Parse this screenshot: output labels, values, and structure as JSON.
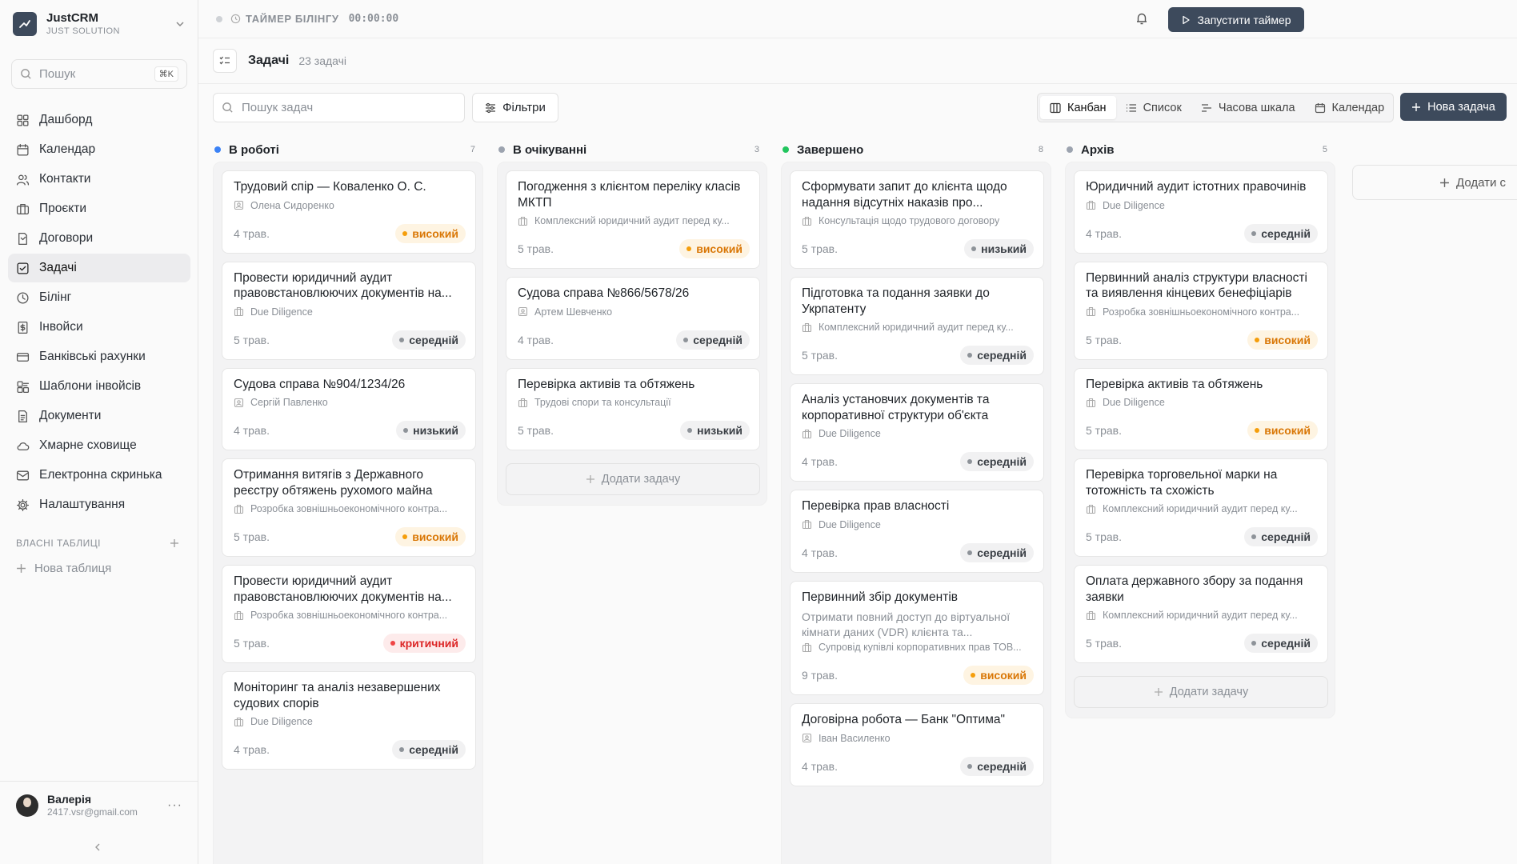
{
  "sidebar": {
    "brand_name": "JustCRM",
    "brand_sub": "JUST SOLUTION",
    "search_placeholder": "Пошук",
    "search_shortcut": "⌘K",
    "items": [
      {
        "label": "Дашборд",
        "icon": "dashboard-icon"
      },
      {
        "label": "Календар",
        "icon": "calendar-icon"
      },
      {
        "label": "Контакти",
        "icon": "users-icon"
      },
      {
        "label": "Проєкти",
        "icon": "briefcase-icon"
      },
      {
        "label": "Договори",
        "icon": "contract-icon"
      },
      {
        "label": "Задачі",
        "icon": "task-icon",
        "active": true
      },
      {
        "label": "Білінг",
        "icon": "clock-icon"
      },
      {
        "label": "Інвойси",
        "icon": "invoice-icon"
      },
      {
        "label": "Банківські рахунки",
        "icon": "bank-card-icon"
      },
      {
        "label": "Шаблони інвойсів",
        "icon": "template-icon"
      },
      {
        "label": "Документи",
        "icon": "document-icon"
      },
      {
        "label": "Хмарне сховище",
        "icon": "cloud-icon"
      },
      {
        "label": "Електронна скринька",
        "icon": "mail-icon"
      },
      {
        "label": "Налаштування",
        "icon": "gear-icon"
      }
    ],
    "section_label": "ВЛАСНІ ТАБЛИЦІ",
    "new_table": "Нова таблиця",
    "user": {
      "name": "Валерія",
      "email": "2417.vsr@gmail.com"
    }
  },
  "topbar": {
    "timer_label": "ТАЙМЕР БІЛІНГУ",
    "timer_value": "00:00:00",
    "start_timer": "Запустити таймер"
  },
  "page": {
    "title": "Задачі",
    "count": "23 задачі"
  },
  "toolbar": {
    "search_placeholder": "Пошук задач",
    "filters": "Фільтри",
    "views": [
      "Канбан",
      "Список",
      "Часова шкала",
      "Календар"
    ],
    "active_view": "Канбан",
    "new_task": "Нова задача"
  },
  "colors": {
    "accent": "#3d4a5c",
    "in_progress": "#3b82f6",
    "waiting": "#9ca3af",
    "done": "#22c55e",
    "archive": "#9ca3af",
    "priority_high": "#d97706",
    "priority_critical": "#dc2626"
  },
  "board": {
    "add_task": "Додати задачу",
    "add_column": "Додати с",
    "columns": [
      {
        "title": "В роботі",
        "count": "7",
        "cards": [
          {
            "title": "Трудовий спір — Коваленко О. С.",
            "meta_icon": "person-icon",
            "meta": "Олена Сидоренко",
            "date": "4 трав.",
            "priority": "високий",
            "level": "high"
          },
          {
            "title": "Провести юридичний аудит правовстановлюючих документів на...",
            "meta_icon": "building-icon",
            "meta": "Due Diligence",
            "date": "5 трав.",
            "priority": "середній",
            "level": "mid"
          },
          {
            "title": "Судова справа №904/1234/26",
            "meta_icon": "person-icon",
            "meta": "Сергій Павленко",
            "date": "4 трав.",
            "priority": "низький",
            "level": "low"
          },
          {
            "title": "Отримання витягів з Державного реєстру обтяжень рухомого майна",
            "meta_icon": "building-icon",
            "meta": "Розробка зовнішньоекономічного контра...",
            "date": "5 трав.",
            "priority": "високий",
            "level": "high"
          },
          {
            "title": "Провести юридичний аудит правовстановлюючих документів на...",
            "meta_icon": "building-icon",
            "meta": "Розробка зовнішньоекономічного контра...",
            "date": "5 трав.",
            "priority": "критичний",
            "level": "crit"
          },
          {
            "title": "Моніторинг та аналіз незавершених судових спорів",
            "meta_icon": "building-icon",
            "meta": "Due Diligence",
            "date": "4 трав.",
            "priority": "середній",
            "level": "mid"
          }
        ]
      },
      {
        "title": "В очікуванні",
        "count": "3",
        "cards": [
          {
            "title": "Погодження з клієнтом переліку класів МКТП",
            "meta_icon": "building-icon",
            "meta": "Комплексний юридичний аудит перед ку...",
            "date": "5 трав.",
            "priority": "високий",
            "level": "high"
          },
          {
            "title": "Судова справа №866/5678/26",
            "meta_icon": "person-icon",
            "meta": "Артем Шевченко",
            "date": "4 трав.",
            "priority": "середній",
            "level": "mid"
          },
          {
            "title": "Перевірка активів та обтяжень",
            "meta_icon": "building-icon",
            "meta": "Трудові спори та консультації",
            "date": "5 трав.",
            "priority": "низький",
            "level": "low"
          }
        ]
      },
      {
        "title": "Завершено",
        "count": "8",
        "cards": [
          {
            "title": "Сформувати запит до клієнта щодо надання відсутніх наказів про...",
            "meta_icon": "building-icon",
            "meta": "Консультація щодо трудового договору",
            "date": "5 трав.",
            "priority": "низький",
            "level": "low"
          },
          {
            "title": "Підготовка та подання заявки до Укрпатенту",
            "meta_icon": "building-icon",
            "meta": "Комплексний юридичний аудит перед ку...",
            "date": "5 трав.",
            "priority": "середній",
            "level": "mid"
          },
          {
            "title": "Аналіз установчих документів та корпоративної структури об'єкта",
            "meta_icon": "building-icon",
            "meta": "Due Diligence",
            "date": "4 трав.",
            "priority": "середній",
            "level": "mid"
          },
          {
            "title": "Перевірка прав власності",
            "meta_icon": "building-icon",
            "meta": "Due Diligence",
            "date": "4 трав.",
            "priority": "середній",
            "level": "mid"
          },
          {
            "title": "Первинний збір документів",
            "desc": "Отримати повний доступ до віртуальної кімнати даних (VDR) клієнта та...",
            "meta_icon": "building-icon",
            "meta": "Супровід купівлі корпоративних прав ТОВ...",
            "date": "9 трав.",
            "priority": "високий",
            "level": "high"
          },
          {
            "title": "Договірна робота — Банк \"Оптима\"",
            "meta_icon": "person-icon",
            "meta": "Іван Василенко",
            "date": "4 трав.",
            "priority": "середній",
            "level": "mid"
          }
        ]
      },
      {
        "title": "Архів",
        "count": "5",
        "cards": [
          {
            "title": "Юридичний аудит істотних правочинів",
            "meta_icon": "building-icon",
            "meta": "Due Diligence",
            "date": "4 трав.",
            "priority": "середній",
            "level": "mid"
          },
          {
            "title": "Первинний аналіз структури власності та виявлення кінцевих бенефіціарів",
            "meta_icon": "building-icon",
            "meta": "Розробка зовнішньоекономічного контра...",
            "date": "5 трав.",
            "priority": "високий",
            "level": "high"
          },
          {
            "title": "Перевірка активів та обтяжень",
            "meta_icon": "building-icon",
            "meta": "Due Diligence",
            "date": "5 трав.",
            "priority": "високий",
            "level": "high"
          },
          {
            "title": "Перевірка торговельної марки на тотожність та схожість",
            "meta_icon": "building-icon",
            "meta": "Комплексний юридичний аудит перед ку...",
            "date": "5 трав.",
            "priority": "середній",
            "level": "mid"
          },
          {
            "title": "Оплата державного збору за подання заявки",
            "meta_icon": "building-icon",
            "meta": "Комплексний юридичний аудит перед ку...",
            "date": "5 трав.",
            "priority": "середній",
            "level": "mid"
          }
        ]
      }
    ]
  }
}
